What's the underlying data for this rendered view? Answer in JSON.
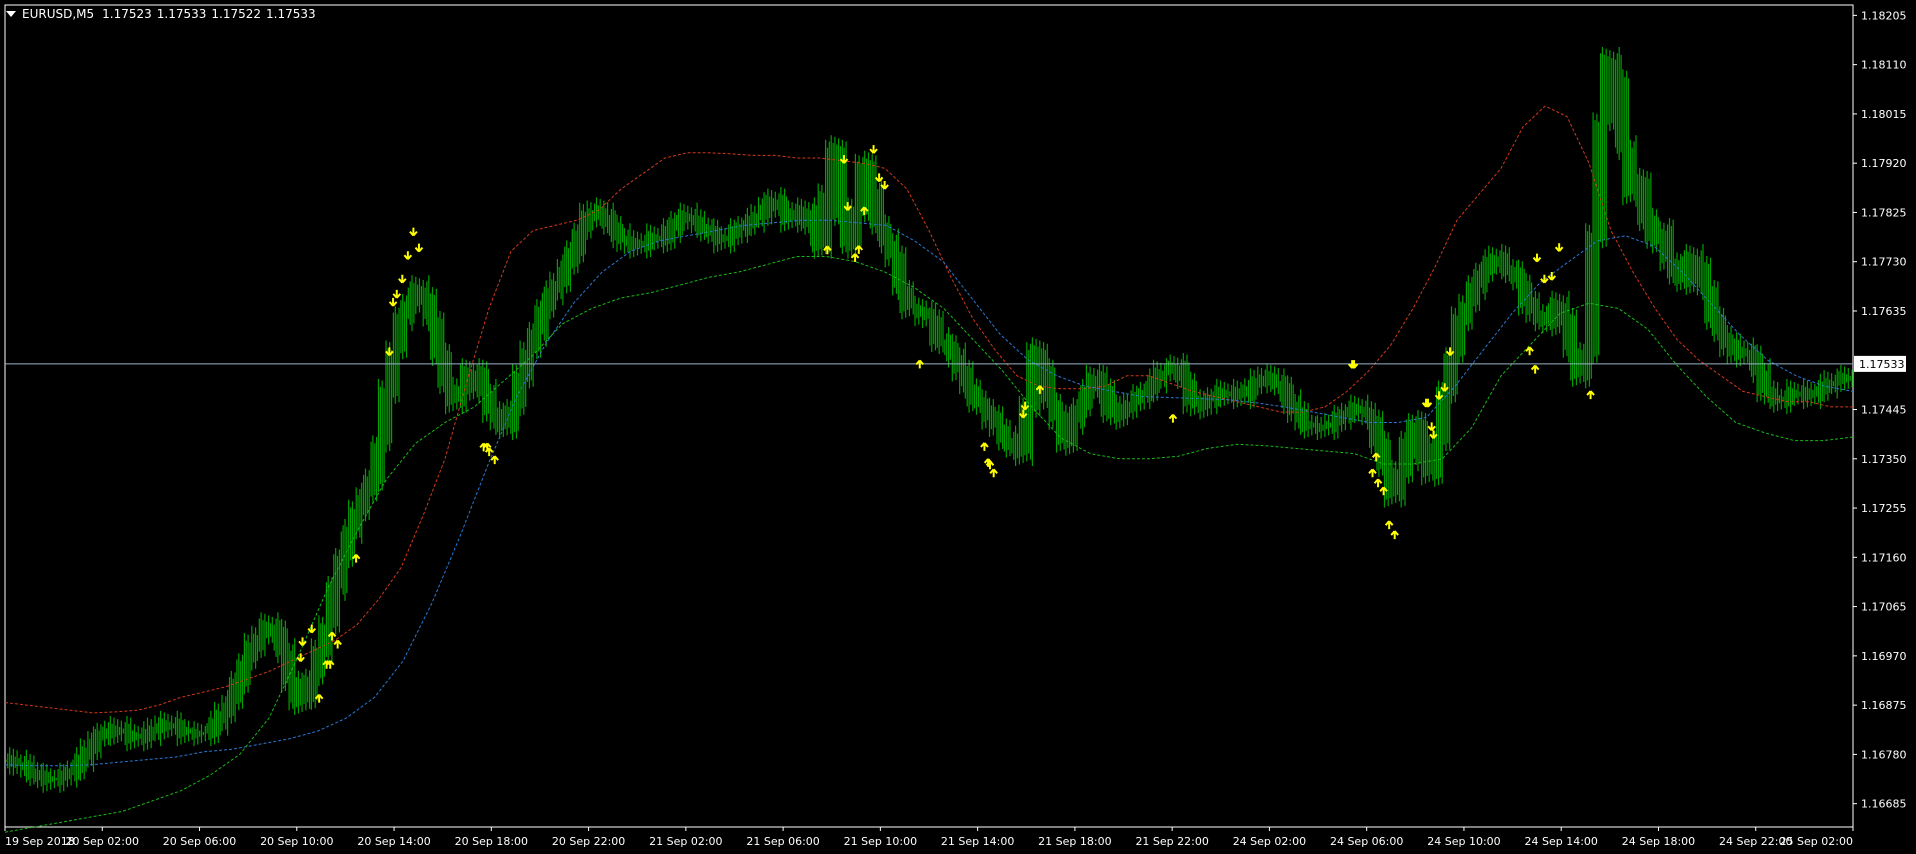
{
  "header": {
    "symbol": "EURUSD,M5",
    "open": "1.17523",
    "high": "1.17533",
    "low": "1.17522",
    "close": "1.17533"
  },
  "chart_data": {
    "type": "line",
    "title": "",
    "xlabel": "",
    "ylabel": "",
    "x_ticks": [
      "19 Sep 2018",
      "20 Sep 02:00",
      "20 Sep 06:00",
      "20 Sep 10:00",
      "20 Sep 14:00",
      "20 Sep 18:00",
      "20 Sep 22:00",
      "21 Sep 02:00",
      "21 Sep 06:00",
      "21 Sep 10:00",
      "21 Sep 14:00",
      "21 Sep 18:00",
      "21 Sep 22:00",
      "24 Sep 02:00",
      "24 Sep 06:00",
      "24 Sep 10:00",
      "24 Sep 14:00",
      "24 Sep 18:00",
      "24 Sep 22:00",
      "25 Sep 02:00"
    ],
    "y_ticks": [
      "1.18205",
      "1.18110",
      "1.18015",
      "1.17920",
      "1.17825",
      "1.17730",
      "1.17635",
      "1.17445",
      "1.17350",
      "1.17255",
      "1.17160",
      "1.17065",
      "1.16970",
      "1.16875",
      "1.16780",
      "1.16685"
    ],
    "ylim": [
      1.1664,
      1.18225
    ],
    "current_price": 1.17533,
    "current_price_label": "1.17533",
    "colors": {
      "background": "#000000",
      "price": "#00a000",
      "upper_band": "#d0391a",
      "middle_band": "#2a78d0",
      "lower_band": "#18b818",
      "arrows": "#ffff00",
      "axis_text": "#ffffff",
      "current_line": "#9ab4c8"
    },
    "series": [
      {
        "name": "price",
        "values": [
          1.1677,
          1.16765,
          1.1676,
          1.1675,
          1.1674,
          1.1673,
          1.1673,
          1.16735,
          1.1674,
          1.1675,
          1.1677,
          1.1679,
          1.1681,
          1.1682,
          1.1683,
          1.1683,
          1.1682,
          1.1681,
          1.1681,
          1.1682,
          1.1683,
          1.1684,
          1.1684,
          1.1683,
          1.1682,
          1.1682,
          1.1682,
          1.1682,
          1.1684,
          1.1686,
          1.1688,
          1.1692,
          1.1696,
          1.1699,
          1.1701,
          1.1703,
          1.1702,
          1.1698,
          1.1692,
          1.1688,
          1.1689,
          1.1693,
          1.1698,
          1.1703,
          1.171,
          1.1716,
          1.1721,
          1.1725,
          1.1728,
          1.1731,
          1.1738,
          1.1748,
          1.1756,
          1.1762,
          1.1765,
          1.1768,
          1.1766,
          1.1762,
          1.1755,
          1.1749,
          1.1746,
          1.1748,
          1.1752,
          1.1752,
          1.1748,
          1.1744,
          1.1742,
          1.1741,
          1.1745,
          1.1751,
          1.1756,
          1.1759,
          1.1764,
          1.1767,
          1.1769,
          1.1772,
          1.1775,
          1.1779,
          1.1782,
          1.1783,
          1.1782,
          1.178,
          1.1778,
          1.1777,
          1.1776,
          1.1776,
          1.1777,
          1.1778,
          1.1777,
          1.1779,
          1.1781,
          1.1782,
          1.1781,
          1.178,
          1.1779,
          1.1778,
          1.1777,
          1.1778,
          1.1779,
          1.178,
          1.1781,
          1.1782,
          1.1784,
          1.1785,
          1.1783,
          1.1781,
          1.1781,
          1.1783,
          1.178,
          1.1776,
          1.1786,
          1.1795,
          1.1782,
          1.1776,
          1.1783,
          1.1792,
          1.1787,
          1.178,
          1.1777,
          1.1774,
          1.1768,
          1.1764,
          1.1764,
          1.1763,
          1.1762,
          1.1758,
          1.1757,
          1.1755,
          1.1752,
          1.1749,
          1.1746,
          1.1745,
          1.1743,
          1.1741,
          1.1739,
          1.1737,
          1.1736,
          1.1745,
          1.1756,
          1.1752,
          1.1746,
          1.1743,
          1.1738,
          1.1742,
          1.1745,
          1.1748,
          1.1751,
          1.1749,
          1.1744,
          1.1743,
          1.1745,
          1.1746,
          1.1747,
          1.1748,
          1.175,
          1.1752,
          1.1752,
          1.1753,
          1.175,
          1.1746,
          1.1745,
          1.1746,
          1.1747,
          1.1748,
          1.1748,
          1.1747,
          1.1747,
          1.1749,
          1.175,
          1.1751,
          1.175,
          1.1749,
          1.1746,
          1.1744,
          1.1742,
          1.1741,
          1.1741,
          1.1741,
          1.1742,
          1.1743,
          1.1744,
          1.1745,
          1.1744,
          1.1743,
          1.1738,
          1.1733,
          1.1728,
          1.1732,
          1.1738,
          1.1742,
          1.1735,
          1.1732,
          1.1738,
          1.1748,
          1.1755,
          1.1762,
          1.1765,
          1.1768,
          1.1771,
          1.1773,
          1.1774,
          1.1772,
          1.1771,
          1.1769,
          1.1765,
          1.1763,
          1.1762,
          1.1761,
          1.1765,
          1.1762,
          1.1756,
          1.1751,
          1.1755,
          1.1778,
          1.18,
          1.1812,
          1.1808,
          1.1795,
          1.1786,
          1.1789,
          1.1781,
          1.1777,
          1.1779,
          1.1773,
          1.1771,
          1.1769,
          1.1774,
          1.1772,
          1.1768,
          1.1762,
          1.1759,
          1.1757,
          1.1755,
          1.1756,
          1.1755,
          1.1752,
          1.1748,
          1.1747,
          1.1746,
          1.1747,
          1.1748,
          1.1747,
          1.1747,
          1.1748,
          1.1749,
          1.175,
          1.175,
          1.1751
        ]
      },
      {
        "name": "upper_band",
        "values": [
          1.1688,
          1.16875,
          1.1687,
          1.16865,
          1.1686,
          1.16862,
          1.16865,
          1.16875,
          1.1689,
          1.169,
          1.1691,
          1.16925,
          1.1694,
          1.1696,
          1.1698,
          1.17,
          1.1703,
          1.1708,
          1.1714,
          1.1724,
          1.1735,
          1.175,
          1.1764,
          1.1775,
          1.1779,
          1.178,
          1.1781,
          1.1783,
          1.1787,
          1.179,
          1.1793,
          1.1794,
          1.1794,
          1.17938,
          1.17935,
          1.17935,
          1.1793,
          1.1793,
          1.17925,
          1.1792,
          1.1791,
          1.1787,
          1.1779,
          1.177,
          1.1762,
          1.1756,
          1.1751,
          1.1749,
          1.17485,
          1.17485,
          1.1749,
          1.1751,
          1.1751,
          1.17495,
          1.1748,
          1.1747,
          1.1746,
          1.1745,
          1.1744,
          1.1744,
          1.1745,
          1.1748,
          1.1752,
          1.1757,
          1.1764,
          1.1772,
          1.1781,
          1.1786,
          1.1791,
          1.1799,
          1.1803,
          1.1801,
          1.1792,
          1.1779,
          1.1771,
          1.1764,
          1.1758,
          1.1754,
          1.1751,
          1.1748,
          1.1747,
          1.1746,
          1.1746,
          1.1745,
          1.1745
        ]
      },
      {
        "name": "middle_band",
        "values": [
          1.1676,
          1.16758,
          1.16758,
          1.1676,
          1.16765,
          1.1677,
          1.16775,
          1.16785,
          1.1679,
          1.168,
          1.1681,
          1.16825,
          1.1685,
          1.1689,
          1.1696,
          1.1707,
          1.172,
          1.1734,
          1.1747,
          1.1757,
          1.1765,
          1.1771,
          1.1775,
          1.1777,
          1.1778,
          1.1779,
          1.178,
          1.17805,
          1.1781,
          1.1781,
          1.17805,
          1.178,
          1.1777,
          1.1773,
          1.1766,
          1.1759,
          1.1754,
          1.1751,
          1.1749,
          1.1748,
          1.1747,
          1.17468,
          1.17466,
          1.17464,
          1.17458,
          1.1745,
          1.1744,
          1.1743,
          1.1742,
          1.1742,
          1.1743,
          1.1749,
          1.1756,
          1.1763,
          1.1769,
          1.1773,
          1.1777,
          1.1778,
          1.1776,
          1.1771,
          1.1765,
          1.1759,
          1.1754,
          1.1751,
          1.1749,
          1.1748
        ]
      },
      {
        "name": "lower_band",
        "values": [
          1.1663,
          1.1664,
          1.1665,
          1.1666,
          1.1667,
          1.1669,
          1.1671,
          1.1674,
          1.1678,
          1.1685,
          1.1697,
          1.171,
          1.1721,
          1.1731,
          1.1738,
          1.1742,
          1.1745,
          1.175,
          1.1755,
          1.1761,
          1.1764,
          1.1766,
          1.1767,
          1.17685,
          1.177,
          1.1771,
          1.17725,
          1.1774,
          1.1774,
          1.1773,
          1.1771,
          1.1768,
          1.1764,
          1.1758,
          1.1752,
          1.1745,
          1.1739,
          1.1736,
          1.1735,
          1.1735,
          1.17355,
          1.1737,
          1.17378,
          1.17375,
          1.1737,
          1.17365,
          1.1736,
          1.1734,
          1.1734,
          1.1735,
          1.1741,
          1.1751,
          1.1757,
          1.1763,
          1.1765,
          1.1764,
          1.176,
          1.1753,
          1.1747,
          1.1742,
          1.174,
          1.17385,
          1.17385,
          1.17392
        ]
      }
    ],
    "up_arrows_count": 30,
    "down_arrows_count": 30
  }
}
